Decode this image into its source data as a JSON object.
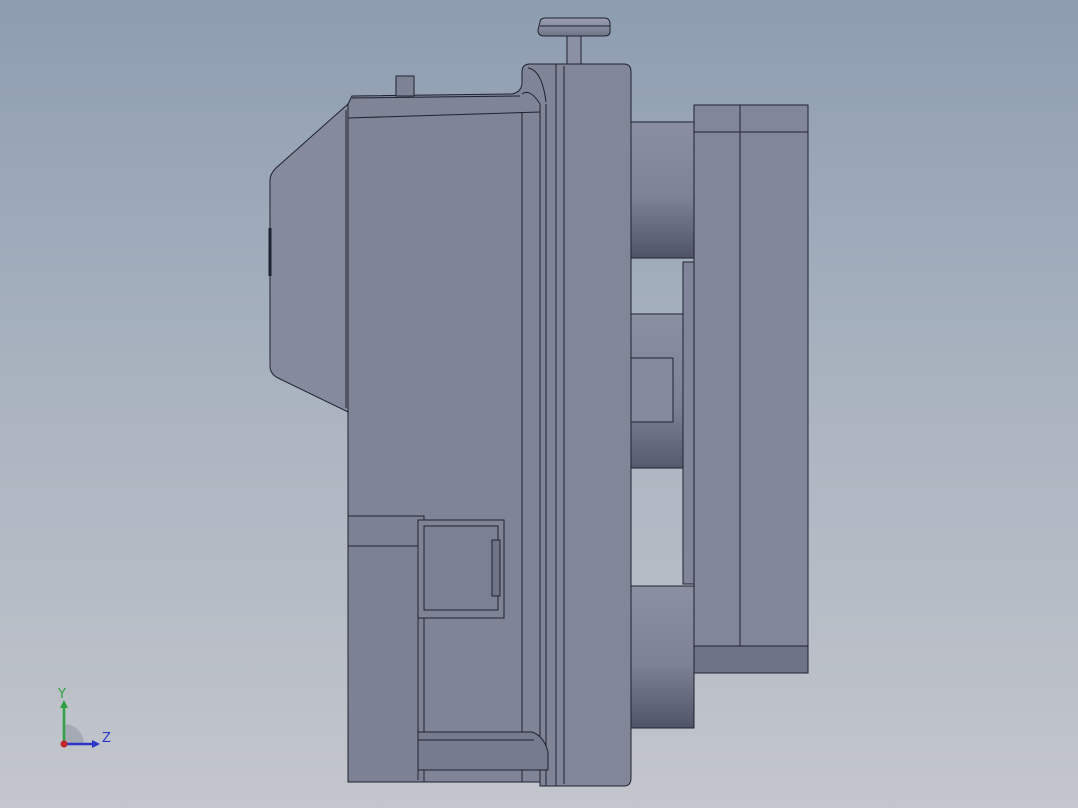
{
  "viewport": {
    "background_top": "#8d9db0",
    "background_bottom": "#c3c6cc"
  },
  "model": {
    "name": "",
    "body_color": "#7e8396",
    "edge_color": "#1f2230"
  },
  "triad": {
    "y_label": "Y",
    "z_label": "Z",
    "y_color": "#2ea043",
    "z_color": "#2b35c8",
    "x_color": "#c0262b"
  }
}
